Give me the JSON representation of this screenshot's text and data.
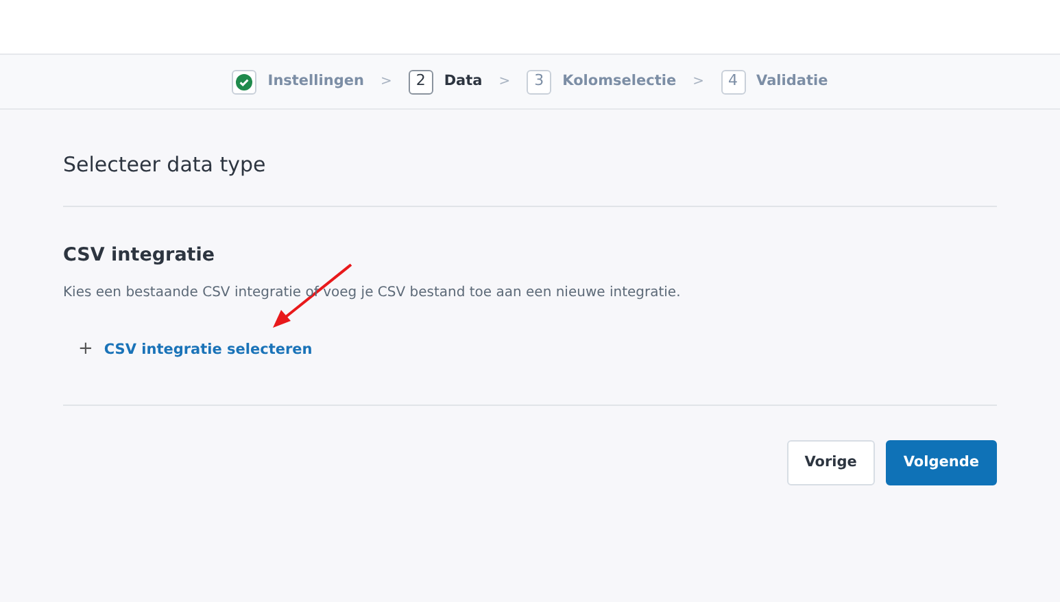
{
  "steps": [
    {
      "label": "Instellingen",
      "done": true,
      "selected": false
    },
    {
      "number": "2",
      "label": "Data",
      "done": false,
      "selected": true
    },
    {
      "number": "3",
      "label": "Kolomselectie",
      "done": false,
      "selected": false
    },
    {
      "number": "4",
      "label": "Validatie",
      "done": false,
      "selected": false
    }
  ],
  "step_separator": ">",
  "title": "Selecteer data type",
  "section": {
    "heading": "CSV integratie",
    "description": "Kies een bestaande CSV integratie of voeg je CSV bestand toe aan een nieuwe integratie.",
    "add_link": {
      "icon": "+",
      "label": "CSV integratie selecteren"
    }
  },
  "buttons": [
    {
      "label": "Vorige",
      "kind": "secondary"
    },
    {
      "label": "Volgende",
      "kind": "primary"
    }
  ],
  "annotation": {
    "kind": "arrow"
  }
}
